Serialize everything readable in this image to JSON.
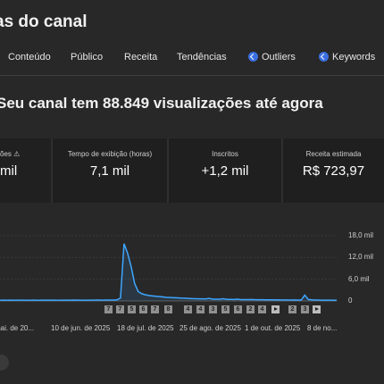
{
  "header": {
    "title": "as do canal"
  },
  "tabs": [
    {
      "label": "Conteúdo",
      "icon": ""
    },
    {
      "label": "Público",
      "icon": ""
    },
    {
      "label": "Receita",
      "icon": ""
    },
    {
      "label": "Tendências",
      "icon": ""
    },
    {
      "label": "Outliers",
      "icon": "extension-icon"
    },
    {
      "label": "Keywords",
      "icon": "extension-icon"
    }
  ],
  "headline": "Seu canal tem 88.849 visualizações até agora",
  "cards": [
    {
      "label": "ões",
      "value": "mil",
      "has_warning": true
    },
    {
      "label": "Tempo de exibição (horas)",
      "value": "7,1 mil"
    },
    {
      "label": "Inscritos",
      "value": "+1,2 mil"
    },
    {
      "label": "Receita estimada",
      "value": "R$ 723,97"
    }
  ],
  "chart_data": {
    "type": "line",
    "yticks": [
      "18,0 mil",
      "12,0 mil",
      "6,0 mil",
      "0"
    ],
    "ylim": [
      0,
      18000
    ],
    "xticks": [
      "mai. de 20...",
      "10 de jun. de 2025",
      "18 de jul. de 2025",
      "25 de ago. de 2025",
      "1 de out. de 2025",
      "8 de no..."
    ],
    "series": [
      {
        "color": "#3ea6ff",
        "values": [
          200,
          210,
          190,
          220,
          200,
          210,
          230,
          200,
          190,
          210,
          220,
          200,
          210,
          220,
          230,
          210,
          200,
          190,
          210,
          220,
          230,
          240,
          220,
          210,
          200,
          220,
          230,
          250,
          240,
          230,
          250,
          260,
          240,
          300,
          800,
          15800,
          13200,
          9500,
          4800,
          2600,
          2000,
          1700,
          1500,
          1400,
          1300,
          1200,
          1100,
          1000,
          950,
          900,
          850,
          800,
          780,
          700,
          650,
          620,
          600,
          580,
          550,
          700,
          500,
          480,
          450,
          600,
          430,
          420,
          400,
          500,
          380,
          370,
          360,
          400,
          350,
          340,
          330,
          320,
          310,
          300,
          320,
          290,
          280,
          270,
          260,
          270,
          250,
          240,
          1600,
          400,
          300,
          250,
          240,
          230,
          220,
          210,
          200,
          190
        ]
      }
    ],
    "annotations": [
      "7",
      "7",
      "5",
      "6",
      "7",
      "8",
      "4",
      "4",
      "3",
      "5",
      "6",
      "2",
      "4",
      "2",
      "3"
    ]
  },
  "colors": {
    "background": "#282828",
    "card": "#1f1f1f",
    "accent": "#3ea6ff"
  }
}
